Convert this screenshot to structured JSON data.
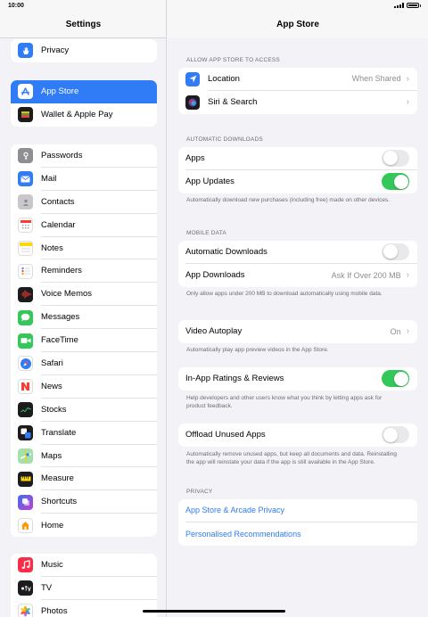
{
  "status_bar": {
    "time": "10:00"
  },
  "sidebar": {
    "title": "Settings",
    "group_top": [
      {
        "label": "Privacy",
        "icon": "hand-icon",
        "color": "#2f7cf6"
      }
    ],
    "group_store": [
      {
        "label": "App Store",
        "icon": "app-store-icon",
        "color": "#2f7cf6",
        "selected": true
      },
      {
        "label": "Wallet & Apple Pay",
        "icon": "wallet-icon",
        "color": "#1c1c1e"
      }
    ],
    "group_apps": [
      {
        "label": "Passwords",
        "icon": "key-icon",
        "color": "#8e8e93"
      },
      {
        "label": "Mail",
        "icon": "mail-icon",
        "color": "#2f7cf6"
      },
      {
        "label": "Contacts",
        "icon": "contacts-icon",
        "color": "#a8a8ad"
      },
      {
        "label": "Calendar",
        "icon": "calendar-icon",
        "color": "#ffffff"
      },
      {
        "label": "Notes",
        "icon": "notes-icon",
        "color": "#ffffff"
      },
      {
        "label": "Reminders",
        "icon": "reminders-icon",
        "color": "#ffffff"
      },
      {
        "label": "Voice Memos",
        "icon": "voice-memos-icon",
        "color": "#1c1c1e"
      },
      {
        "label": "Messages",
        "icon": "messages-icon",
        "color": "#34c759"
      },
      {
        "label": "FaceTime",
        "icon": "facetime-icon",
        "color": "#34c759"
      },
      {
        "label": "Safari",
        "icon": "safari-icon",
        "color": "#2f7cf6"
      },
      {
        "label": "News",
        "icon": "news-icon",
        "color": "#ffffff"
      },
      {
        "label": "Stocks",
        "icon": "stocks-icon",
        "color": "#1c1c1e"
      },
      {
        "label": "Translate",
        "icon": "translate-icon",
        "color": "#1c1c1e"
      },
      {
        "label": "Maps",
        "icon": "maps-icon",
        "color": "#6fcf7f"
      },
      {
        "label": "Measure",
        "icon": "measure-icon",
        "color": "#1c1c1e"
      },
      {
        "label": "Shortcuts",
        "icon": "shortcuts-icon",
        "color": "#5b4fd6"
      },
      {
        "label": "Home",
        "icon": "home-icon",
        "color": "#ffffff"
      }
    ],
    "group_media": [
      {
        "label": "Music",
        "icon": "music-icon",
        "color": "#fa2d48"
      },
      {
        "label": "TV",
        "icon": "tv-icon",
        "color": "#1c1c1e"
      },
      {
        "label": "Photos",
        "icon": "photos-icon",
        "color": "#ffffff"
      }
    ]
  },
  "main": {
    "title": "App Store",
    "access": {
      "header": "ALLOW APP STORE TO ACCESS",
      "location_label": "Location",
      "location_value": "When Shared",
      "siri_label": "Siri & Search"
    },
    "auto_downloads": {
      "header": "AUTOMATIC DOWNLOADS",
      "apps_label": "Apps",
      "apps_on": false,
      "updates_label": "App Updates",
      "updates_on": true,
      "footer": "Automatically download new purchases (including free) made on other devices."
    },
    "mobile_data": {
      "header": "MOBILE DATA",
      "auto_label": "Automatic Downloads",
      "auto_on": false,
      "app_downloads_label": "App Downloads",
      "app_downloads_value": "Ask If Over 200 MB",
      "footer": "Only allow apps under 200 MB to download automatically using mobile data."
    },
    "video": {
      "label": "Video Autoplay",
      "value": "On",
      "footer": "Automatically play app preview videos in the App Store."
    },
    "ratings": {
      "label": "In-App Ratings & Reviews",
      "on": true,
      "footer": "Help developers and other users know what you think by letting apps ask for product feedback."
    },
    "offload": {
      "label": "Offload Unused Apps",
      "on": false,
      "footer": "Automatically remove unused apps, but keep all documents and data. Reinstalling the app will reinstate your data if the app is still available in the App Store."
    },
    "privacy": {
      "header": "PRIVACY",
      "link1": "App Store & Arcade Privacy",
      "link2": "Personalised Recommendations"
    }
  }
}
